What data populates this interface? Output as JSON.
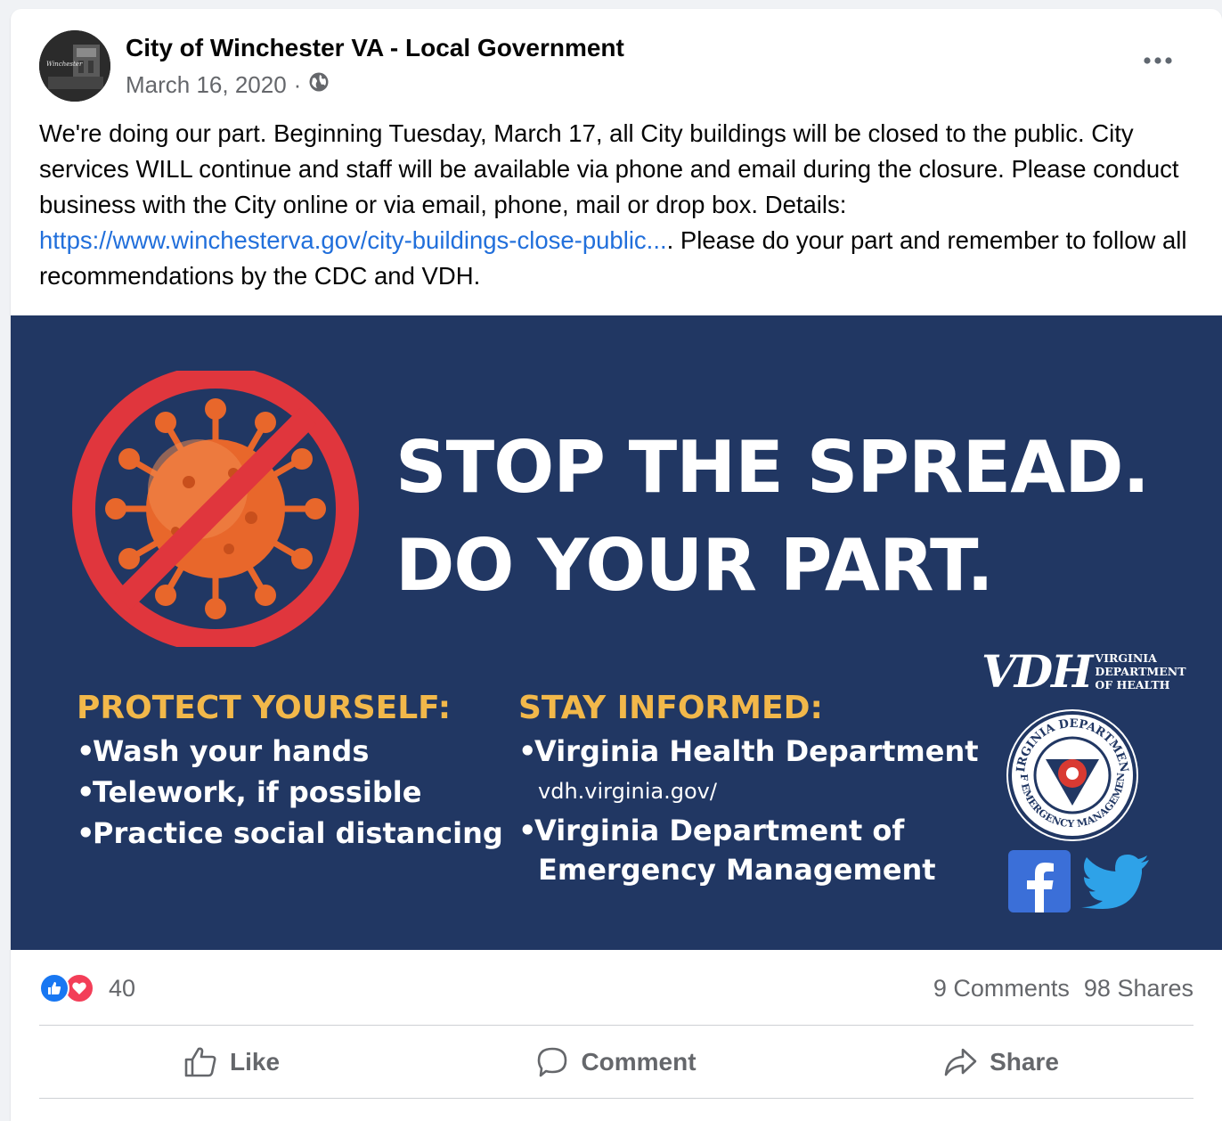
{
  "post": {
    "author": "City of Winchester VA - Local Government",
    "avatar_text": "Winchester",
    "date": "March 16, 2020",
    "separator": "·",
    "privacy_icon": "globe-icon",
    "more_icon": "more-horizontal-icon",
    "text_part1": "We're doing our part. Beginning Tuesday, March 17, all City buildings will be closed to the public. City services WILL continue and staff will be available via phone and email during the closure. Please conduct business with the City online or via email, phone, mail or drop box. Details: ",
    "link_text": "https://www.winchesterva.gov/city-buildings-close-public...",
    "text_part2": ". Please do your part and remember to follow all recommendations by the CDC and VDH."
  },
  "banner": {
    "headline_line1": "STOP THE SPREAD.",
    "headline_line2": "DO YOUR PART.",
    "protect_title": "PROTECT YOURSELF:",
    "protect_items": [
      "Wash your hands",
      "Telework, if possible",
      "Practice social distancing"
    ],
    "informed_title": "STAY INFORMED:",
    "informed_item1": "Virginia Health Department",
    "informed_item1_url": "vdh.virginia.gov/",
    "informed_item2_line1": "Virginia Department of",
    "informed_item2_line2": "Emergency Management",
    "vdh_letters": "VDH",
    "vdh_words": [
      "VIRGINIA",
      "DEPARTMENT",
      "OF HEALTH"
    ],
    "seal_top": "VIRGINIA DEPARTMENT",
    "seal_bottom": "OF EMERGENCY MANAGEMENT",
    "bullet": "•",
    "colors": {
      "background": "#213763",
      "accent": "#f2b84a",
      "ban": "#e0363d",
      "virus": "#e8672b"
    }
  },
  "stats": {
    "reaction_count": "40",
    "comments": "9 Comments",
    "shares": "98 Shares"
  },
  "actions": {
    "like": "Like",
    "comment": "Comment",
    "share": "Share"
  }
}
